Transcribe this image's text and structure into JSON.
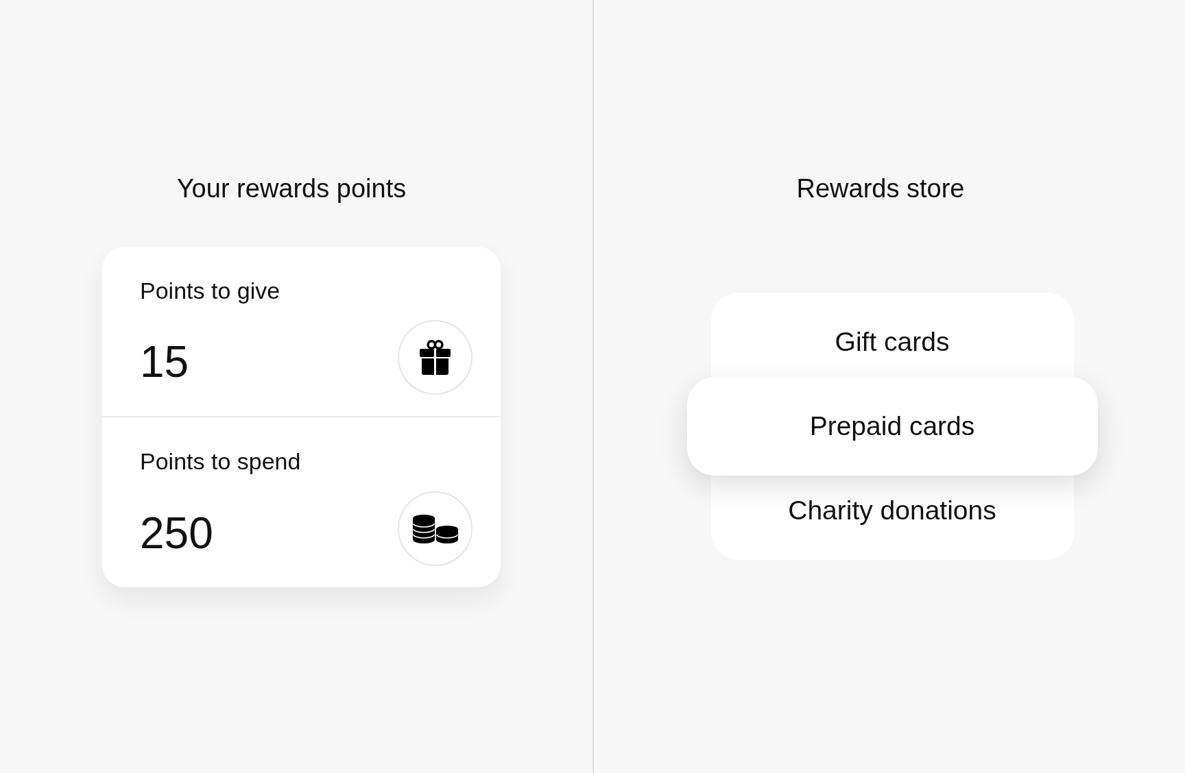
{
  "points_panel": {
    "heading": "Your rewards points",
    "items": [
      {
        "kind": "give",
        "label": "Points to give",
        "value": "15"
      },
      {
        "kind": "spend",
        "label": "Points to spend",
        "value": "250"
      }
    ]
  },
  "store": {
    "heading": "Rewards store",
    "options": [
      {
        "label": "Gift cards",
        "selected": false
      },
      {
        "label": "Prepaid cards",
        "selected": true
      },
      {
        "label": "Charity donations",
        "selected": false
      }
    ]
  }
}
